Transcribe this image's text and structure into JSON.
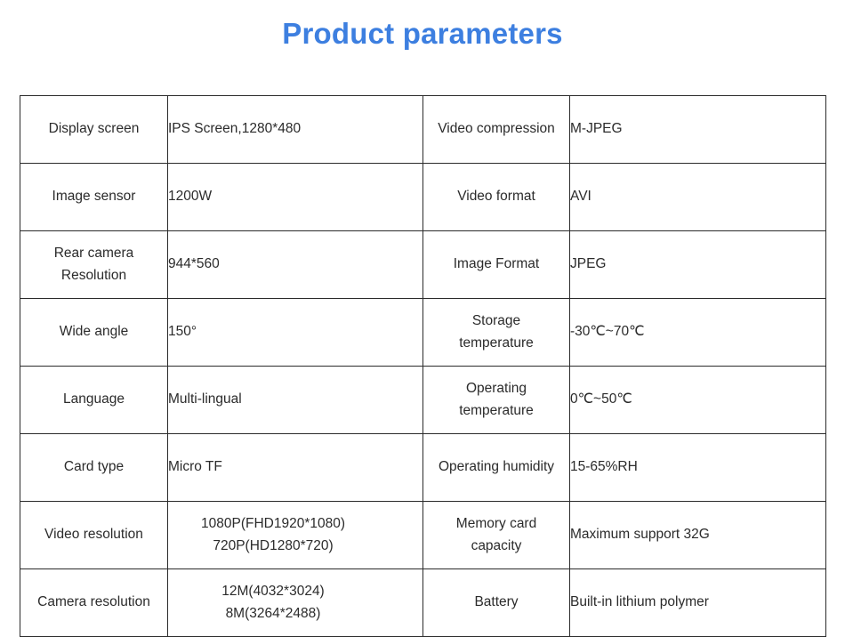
{
  "header": {
    "title": "Product parameters",
    "title_color": "#3d7fe0"
  },
  "table": {
    "border_color": "#2b2b2b",
    "text_color": "#2b2b2b",
    "rows": [
      {
        "label_a": "Display screen",
        "value_a": "IPS Screen,1280*480",
        "label_b": "Video compression",
        "value_b": "M-JPEG"
      },
      {
        "label_a": "Image sensor",
        "value_a": "1200W",
        "label_b": "Video format",
        "value_b": "AVI"
      },
      {
        "label_a_line1": "Rear camera",
        "label_a_line2": "Resolution",
        "value_a": "944*560",
        "label_b": "Image Format",
        "value_b": "JPEG"
      },
      {
        "label_a": "Wide angle",
        "value_a": "150°",
        "label_b_line1": "Storage",
        "label_b_line2": "temperature",
        "value_b": "-30℃~70℃"
      },
      {
        "label_a": "Language",
        "value_a": "Multi-lingual",
        "label_b_line1": "Operating",
        "label_b_line2": "temperature",
        "value_b": "0℃~50℃"
      },
      {
        "label_a": "Card type",
        "value_a": "Micro TF",
        "label_b": "Operating humidity",
        "value_b": "15-65%RH"
      },
      {
        "label_a": "Video resolution",
        "value_a_line1": "1080P(FHD1920*1080)",
        "value_a_line2": "720P(HD1280*720)",
        "label_b_line1": "Memory card",
        "label_b_line2": "capacity",
        "value_b": "Maximum support 32G"
      },
      {
        "label_a": "Camera resolution",
        "value_a_line1": "12M(4032*3024)",
        "value_a_line2": "8M(3264*2488)",
        "label_b": "Battery",
        "value_b": "Built-in lithium polymer"
      }
    ]
  }
}
